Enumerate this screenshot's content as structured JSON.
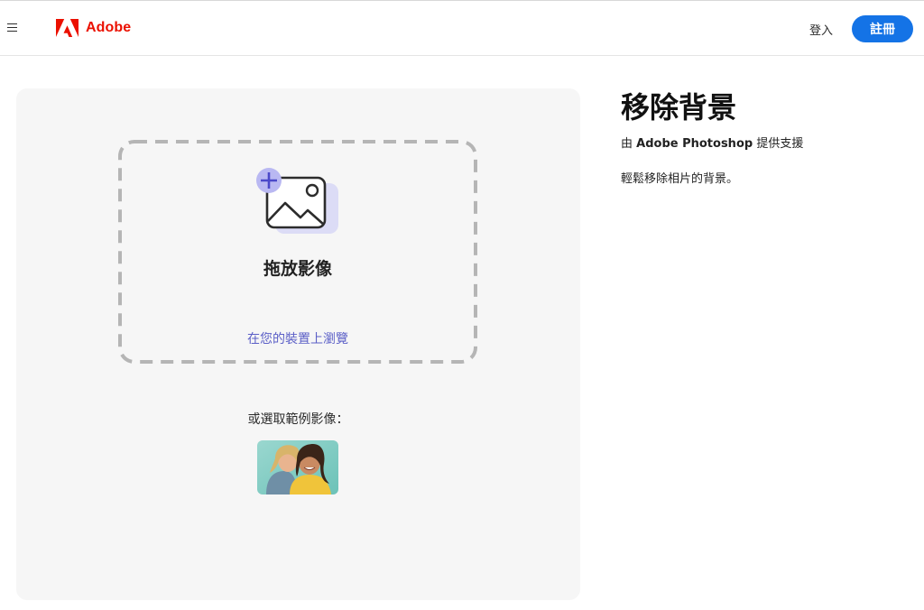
{
  "header": {
    "menu_icon": "hamburger-menu-icon",
    "brand_name": "Adobe",
    "brand_color": "#eb1000",
    "signin_label": "登入",
    "signup_label": "註冊",
    "signup_color": "#1473e6"
  },
  "upload": {
    "icon": "add-image-icon",
    "drop_title": "拖放影像",
    "browse_link": "在您的裝置上瀏覽",
    "link_color": "#5b5fc7"
  },
  "samples": {
    "label": "或選取範例影像：",
    "items": [
      {
        "icon": "sample-photo-two-women"
      }
    ]
  },
  "side": {
    "title": "移除背景",
    "powered_prefix": "由 ",
    "powered_brand": "Adobe Photoshop",
    "powered_suffix": " 提供支援",
    "description": "輕鬆移除相片的背景。"
  }
}
